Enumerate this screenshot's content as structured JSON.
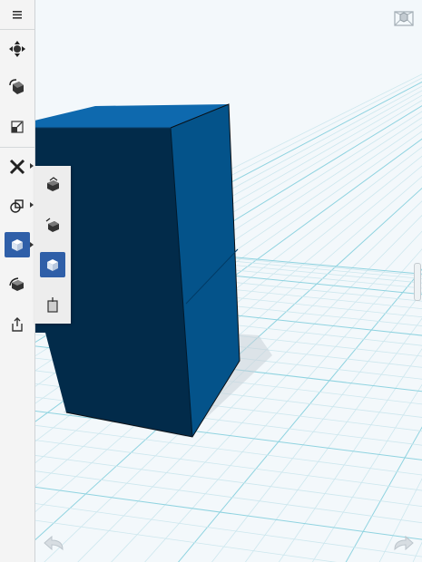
{
  "app": {
    "background": "#f3f8fb",
    "accent": "#2f5fa8"
  },
  "toolbar": {
    "items": [
      {
        "icon": "menu-icon"
      },
      {
        "icon": "move-tool-icon"
      },
      {
        "icon": "rotate-tool-icon"
      },
      {
        "icon": "scale-tool-icon"
      },
      {
        "icon": "sketch-tool-icon"
      },
      {
        "icon": "construct-tool-icon"
      },
      {
        "icon": "primitive-tool-icon",
        "active": true
      },
      {
        "icon": "modify-tool-icon"
      },
      {
        "icon": "share-icon"
      }
    ]
  },
  "flyout": {
    "items": [
      {
        "icon": "extrude-icon"
      },
      {
        "icon": "sweep-icon"
      },
      {
        "icon": "box-primitive-icon",
        "selected": true
      },
      {
        "icon": "shell-icon"
      }
    ]
  },
  "view": {
    "view_cube_icon": "view-cube-icon",
    "undo_icon": "undo-arrow-icon",
    "redo_icon": "redo-arrow-icon",
    "model_colors": {
      "top": "#0e69ae",
      "front": "#022b4a",
      "side": "#04538a",
      "edge": "#0a0f14"
    }
  }
}
